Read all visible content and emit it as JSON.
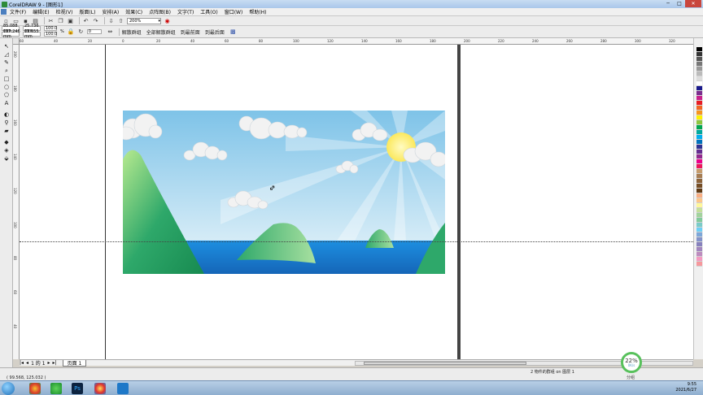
{
  "window": {
    "title": "CorelDRAW 9 - [图形1]",
    "controls": [
      "─",
      "□",
      "✕"
    ]
  },
  "menu": [
    "文件(F)",
    "编辑(E)",
    "检视(V)",
    "版面(L)",
    "安排(A)",
    "效果(C)",
    "点阵图(B)",
    "文字(T)",
    "工具(O)",
    "窗口(W)",
    "帮助(H)"
  ],
  "toolbar": {
    "zoom_value": "200%"
  },
  "property_bar": {
    "x": "85.088 mm",
    "y": "117.246 mm",
    "w": "25.736 mm",
    "h": "11.655 mm",
    "scale_x": "100.0",
    "scale_y": "100.0",
    "scale_unit": "%",
    "angle": "0",
    "buttons": [
      "解散群组",
      "全部解散群组",
      "到最前面",
      "到最后面"
    ]
  },
  "ruler": {
    "top_labels": [
      "60",
      "40",
      "20",
      "0",
      "20",
      "40",
      "60",
      "80",
      "100",
      "120",
      "140",
      "160",
      "180",
      "200",
      "220",
      "240",
      "260",
      "280",
      "300",
      "320"
    ],
    "left_labels": [
      "200",
      "180",
      "160",
      "140",
      "120",
      "100",
      "80",
      "60",
      "40"
    ]
  },
  "page_nav": {
    "first": "|◂",
    "prev": "◂",
    "page_label": "1 的 1",
    "next": "▸",
    "last": "▸|",
    "tab_label": "页面 1"
  },
  "status": {
    "coords": "( 99.568, 125.032 )",
    "info": "2 物件的群组 on 图层 1",
    "perf_percent": "22%",
    "perf_rate": "0K/s",
    "perf_label": "分组"
  },
  "clock": {
    "time": "9:55",
    "date": "2021/6/27"
  },
  "colors": {
    "sky_top": "#7ec3e8",
    "sky_bottom": "#d6ecf7",
    "sea": "#1977c7",
    "hill": "#2ea86a",
    "sun": "#ffef7a"
  },
  "palette": [
    "#000000",
    "#333333",
    "#555555",
    "#777777",
    "#999999",
    "#bbbbbb",
    "#dddddd",
    "#ffffff",
    "#1a1a8c",
    "#7b2d8e",
    "#c8208c",
    "#e81c24",
    "#f26522",
    "#f7941d",
    "#fff200",
    "#8dc63f",
    "#00a651",
    "#00a99d",
    "#00aeef",
    "#0072bc",
    "#2e3192",
    "#662d91",
    "#92278f",
    "#ec008c",
    "#ed145b",
    "#c69c6d",
    "#a67c52",
    "#8c6239",
    "#754c24",
    "#603913",
    "#f9ad81",
    "#fdc689",
    "#fff799",
    "#c4df9b",
    "#a2d39c",
    "#82ca9c",
    "#7accc8",
    "#6dcff6",
    "#7da7d9",
    "#8393ca",
    "#8781bd",
    "#a186be",
    "#bd8cbf",
    "#f49ac1",
    "#f6989d"
  ]
}
